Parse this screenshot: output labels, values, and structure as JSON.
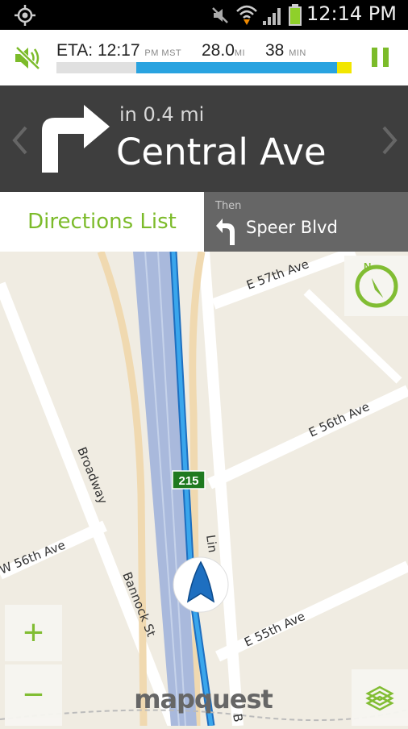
{
  "status_bar": {
    "time": "12:14 PM",
    "icons": [
      "gps-icon",
      "mute-icon",
      "wifi-icon",
      "signal-icon",
      "battery-icon"
    ]
  },
  "eta_bar": {
    "eta_label": "ETA:",
    "eta_time": "12:17",
    "eta_suffix": "PM MST",
    "distance": "28.0",
    "distance_unit": "MI",
    "minutes": "38",
    "minutes_unit": "MIN",
    "progress_fraction": 0.27,
    "colors": {
      "progress": "#29a3e0",
      "remaining": "#e0e0e0",
      "end": "#f2e600"
    }
  },
  "instruction": {
    "distance": "in 0.4 mi",
    "street": "Central Ave",
    "icon": "turn-right-arrow-icon"
  },
  "tabs": {
    "directions_list": "Directions List",
    "then_label": "Then",
    "then_street": "Speer Blvd",
    "then_icon": "turn-left-arrow-icon"
  },
  "map": {
    "labels": {
      "e57": "E 57th Ave",
      "e56": "E 56th Ave",
      "e55": "E 55th Ave",
      "w56": "W 56th Ave",
      "broadway": "Broadway",
      "bannock": "Bannock St",
      "lincoln": "Lin",
      "bottom_street": "B",
      "highway_shield": "215"
    },
    "logo": "mapquest",
    "colors": {
      "background": "#f0ece2",
      "route": "#1e88d2",
      "highway": "#a9b9dc",
      "accent": "#7cbb2a"
    }
  },
  "controls": {
    "zoom_in": "+",
    "zoom_out": "−"
  }
}
